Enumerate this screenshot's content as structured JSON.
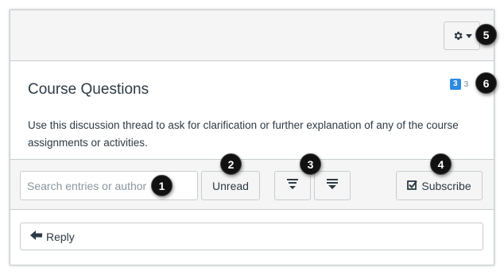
{
  "discussion": {
    "title": "Course Questions",
    "description": "Use this discussion thread to ask for clarification or further explanation of any of the course assignments or activities.",
    "unread_count": "3",
    "total_count": "3"
  },
  "toolbar": {
    "search_placeholder": "Search entries or author",
    "unread_label": "Unread",
    "subscribe_label": "Subscribe",
    "collapse_icon": "collapse-threads-icon",
    "expand_icon": "expand-threads-icon",
    "gear_icon": "gear-icon"
  },
  "reply": {
    "label": "Reply"
  },
  "callouts": [
    "1",
    "2",
    "3",
    "4",
    "5",
    "6"
  ],
  "colors": {
    "accent": "#2d8ae0",
    "text": "#2d3b45",
    "border": "#c7cdd1",
    "panel": "#f5f5f5"
  }
}
